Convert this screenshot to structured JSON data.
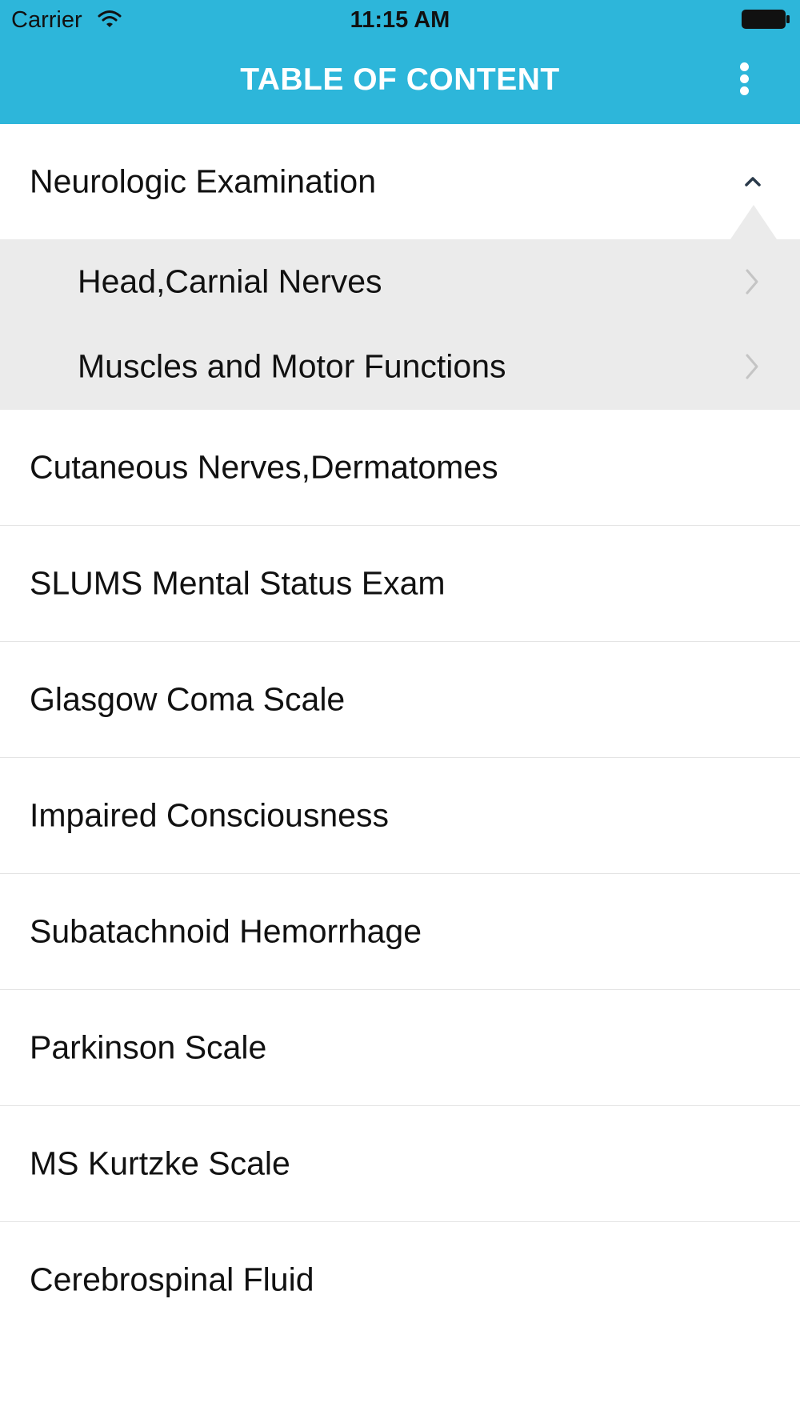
{
  "status_bar": {
    "carrier": "Carrier",
    "time": "11:15 AM"
  },
  "header": {
    "title": "TABLE OF CONTENT",
    "background_color": "#2db6da",
    "menu_icon": "more-vertical-icon"
  },
  "expanded_section": {
    "label": "Neurologic Examination",
    "icon": "chevron-up-icon",
    "items": [
      {
        "label": "Head,Carnial Nerves"
      },
      {
        "label": "Muscles and Motor Functions"
      }
    ]
  },
  "sections": [
    {
      "label": "Cutaneous Nerves,Dermatomes"
    },
    {
      "label": "SLUMS Mental Status Exam"
    },
    {
      "label": "Glasgow Coma Scale"
    },
    {
      "label": "Impaired Consciousness"
    },
    {
      "label": "Subatachnoid Hemorrhage"
    },
    {
      "label": "Parkinson Scale"
    },
    {
      "label": "MS Kurtzke Scale"
    },
    {
      "label": "Cerebrospinal Fluid"
    }
  ]
}
